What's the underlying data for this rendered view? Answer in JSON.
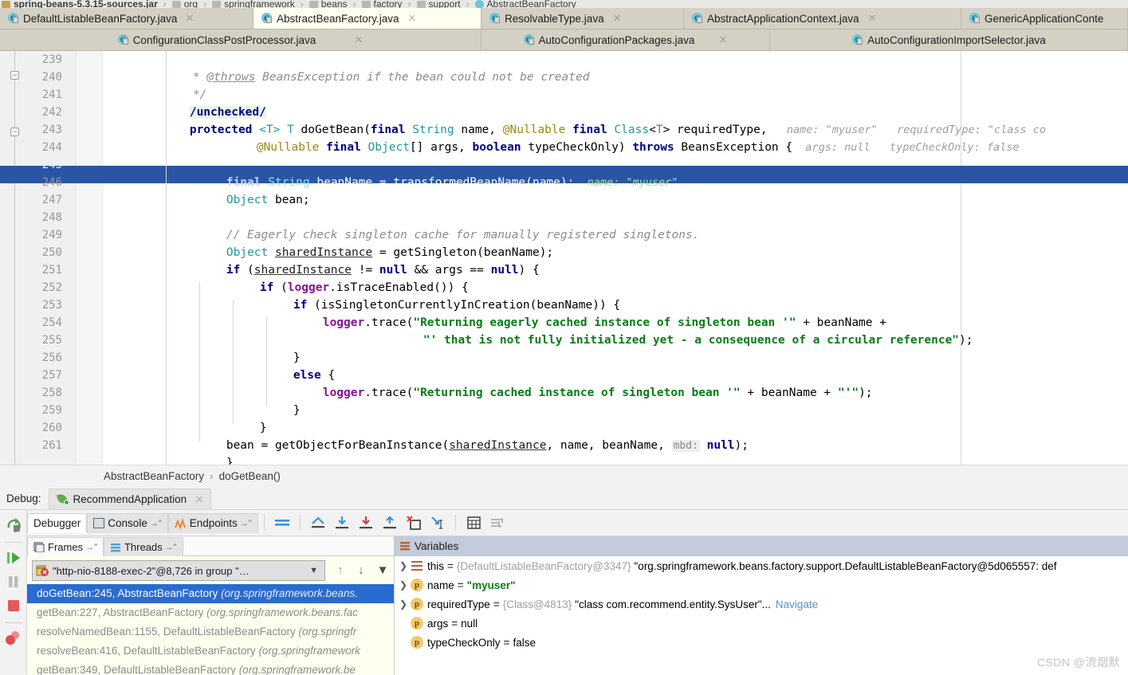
{
  "breadcrumb_top": {
    "items": [
      {
        "label": "spring-beans-5.3.15-sources.jar",
        "icon": "jar-icon",
        "bold": true
      },
      {
        "label": "org",
        "icon": "folder-icon"
      },
      {
        "label": "springframework",
        "icon": "folder-icon"
      },
      {
        "label": "beans",
        "icon": "folder-icon"
      },
      {
        "label": "factory",
        "icon": "folder-icon"
      },
      {
        "label": "support",
        "icon": "folder-icon"
      },
      {
        "label": "AbstractBeanFactory",
        "icon": "class-icon"
      }
    ],
    "separator": "›"
  },
  "editor_tabs": {
    "row1": [
      {
        "label": "DefaultListableBeanFactory.java",
        "active": false,
        "closable": true
      },
      {
        "label": "AbstractBeanFactory.java",
        "active": true,
        "closable": true
      },
      {
        "label": "ResolvableType.java",
        "active": false,
        "closable": true
      },
      {
        "label": "AbstractApplicationContext.java",
        "active": false,
        "closable": true
      },
      {
        "label": "GenericApplicationConte",
        "active": false,
        "closable": false
      }
    ],
    "row2": [
      {
        "label": "ConfigurationClassPostProcessor.java",
        "active": false,
        "closable": true
      },
      {
        "label": "AutoConfigurationPackages.java",
        "active": false,
        "closable": true
      },
      {
        "label": "AutoConfigurationImportSelector.java",
        "active": false,
        "closable": false
      }
    ]
  },
  "editor": {
    "first_line_number": 239,
    "highlighted_line": 245,
    "lines": [
      {
        "n": 239,
        "text": " * @throws BeansException if the bean could not be created"
      },
      {
        "n": 240,
        "text": " */"
      },
      {
        "n": 241,
        "text": "/unchecked/"
      },
      {
        "n": 242,
        "text": "protected <T> T doGetBean(final String name, @Nullable final Class<T> requiredType,"
      },
      {
        "n": 243,
        "text": "        @Nullable final Object[] args, boolean typeCheckOnly) throws BeansException {"
      },
      {
        "n": 244,
        "text": ""
      },
      {
        "n": 245,
        "text": "    final String beanName = transformedBeanName(name);"
      },
      {
        "n": 246,
        "text": "    Object bean;"
      },
      {
        "n": 247,
        "text": ""
      },
      {
        "n": 248,
        "text": "    // Eagerly check singleton cache for manually registered singletons."
      },
      {
        "n": 249,
        "text": "    Object sharedInstance = getSingleton(beanName);"
      },
      {
        "n": 250,
        "text": "    if (sharedInstance != null && args == null) {"
      },
      {
        "n": 251,
        "text": "        if (logger.isTraceEnabled()) {"
      },
      {
        "n": 252,
        "text": "            if (isSingletonCurrentlyInCreation(beanName)) {"
      },
      {
        "n": 253,
        "text": "                logger.trace(\"Returning eagerly cached instance of singleton bean '\" + beanName +"
      },
      {
        "n": 254,
        "text": "                        \"' that is not fully initialized yet - a consequence of a circular reference\");"
      },
      {
        "n": 255,
        "text": "            }"
      },
      {
        "n": 256,
        "text": "            else {"
      },
      {
        "n": 257,
        "text": "                logger.trace(\"Returning cached instance of singleton bean '\" + beanName + \"'\");"
      },
      {
        "n": 258,
        "text": "            }"
      },
      {
        "n": 259,
        "text": "        }"
      },
      {
        "n": 260,
        "text": "        bean = getObjectForBeanInstance(sharedInstance, name, beanName, mbd: null);"
      },
      {
        "n": 261,
        "text": "    }"
      }
    ],
    "inline_hints": {
      "line242": [
        "name: \"myuser\"",
        "requiredType: \"class co"
      ],
      "line243": [
        "args: null",
        "typeCheckOnly: false"
      ],
      "line245": [
        "name: \"myuser\""
      ],
      "line260_param": "mbd:"
    }
  },
  "breadcrumb_bottom": {
    "class": "AbstractBeanFactory",
    "separator": "›",
    "method": "doGetBean()"
  },
  "debug_window": {
    "label": "Debug:",
    "session_tab": "RecommendApplication",
    "tabs": [
      {
        "label": "Debugger",
        "selected": true
      },
      {
        "label": "Console",
        "selected": false,
        "pin": "→\""
      },
      {
        "label": "Endpoints",
        "selected": false,
        "pin": "→\""
      }
    ],
    "toolbar_icons": [
      "mute-breakpoints-icon",
      "show-execution-point-icon",
      "step-over-icon",
      "step-into-icon",
      "force-step-into-icon",
      "step-out-icon",
      "drop-frame-icon",
      "run-to-cursor-icon",
      "evaluate-expression-icon",
      "settings-icon"
    ],
    "left_rail_icons": [
      "rerun-icon",
      "resume-program-icon",
      "pause-program-icon",
      "stop-icon",
      "view-breakpoints-icon"
    ]
  },
  "frames_panel": {
    "tabs": [
      {
        "label": "Frames",
        "selected": true,
        "pin": "→\""
      },
      {
        "label": "Threads",
        "selected": false,
        "pin": "→\""
      }
    ],
    "thread_selector": "\"http-nio-8188-exec-2\"@8,726 in group \"…",
    "toolbar_icons": [
      "arrow-up-icon",
      "arrow-down-icon",
      "filter-icon"
    ],
    "frames": [
      {
        "method": "doGetBean:245, AbstractBeanFactory",
        "pkg": "(org.springframework.beans.",
        "selected": true
      },
      {
        "method": "getBean:227, AbstractBeanFactory",
        "pkg": "(org.springframework.beans.fac",
        "selected": false
      },
      {
        "method": "resolveNamedBean:1155, DefaultListableBeanFactory",
        "pkg": "(org.springfr",
        "selected": false
      },
      {
        "method": "resolveBean:416, DefaultListableBeanFactory",
        "pkg": "(org.springframework",
        "selected": false
      },
      {
        "method": "getBean:349, DefaultListableBeanFactory",
        "pkg": "(org.springframework.be",
        "selected": false
      }
    ]
  },
  "variables_panel": {
    "title": "Variables",
    "rows": [
      {
        "expandable": true,
        "badge": "object",
        "name": "this",
        "eq": "=",
        "ref": "{DefaultListableBeanFactory@3347}",
        "value": "\"org.springframework.beans.factory.support.DefaultListableBeanFactory@5d065557: def",
        "value_kind": "plain"
      },
      {
        "expandable": true,
        "badge": "p",
        "name": "name",
        "eq": "=",
        "ref": "",
        "value": "\"myuser\"",
        "value_kind": "string"
      },
      {
        "expandable": true,
        "badge": "p",
        "name": "requiredType",
        "eq": "=",
        "ref": "{Class@4813}",
        "value": "\"class com.recommend.entity.SysUser\"...",
        "value_kind": "plain",
        "link": "Navigate"
      },
      {
        "expandable": false,
        "badge": "p",
        "name": "args",
        "eq": "=",
        "ref": "",
        "value": "null",
        "value_kind": "plain"
      },
      {
        "expandable": false,
        "badge": "p",
        "name": "typeCheckOnly",
        "eq": "=",
        "ref": "",
        "value": "false",
        "value_kind": "plain"
      }
    ]
  },
  "watermark": "CSDN @流烟默",
  "colors": {
    "tab_bar": "#d4d0c4",
    "active_tab": "#fffff0",
    "selection_blue": "#2a55a5",
    "frame_selected": "#2a6bd1",
    "variables_header": "#c3cbdc",
    "string_green": "#067d17",
    "keyword_navy": "#000080",
    "field_purple": "#871094",
    "comment_gray": "#8c8c8c",
    "annotation_gold": "#9e880d",
    "frames_bg": "#fffff0"
  }
}
